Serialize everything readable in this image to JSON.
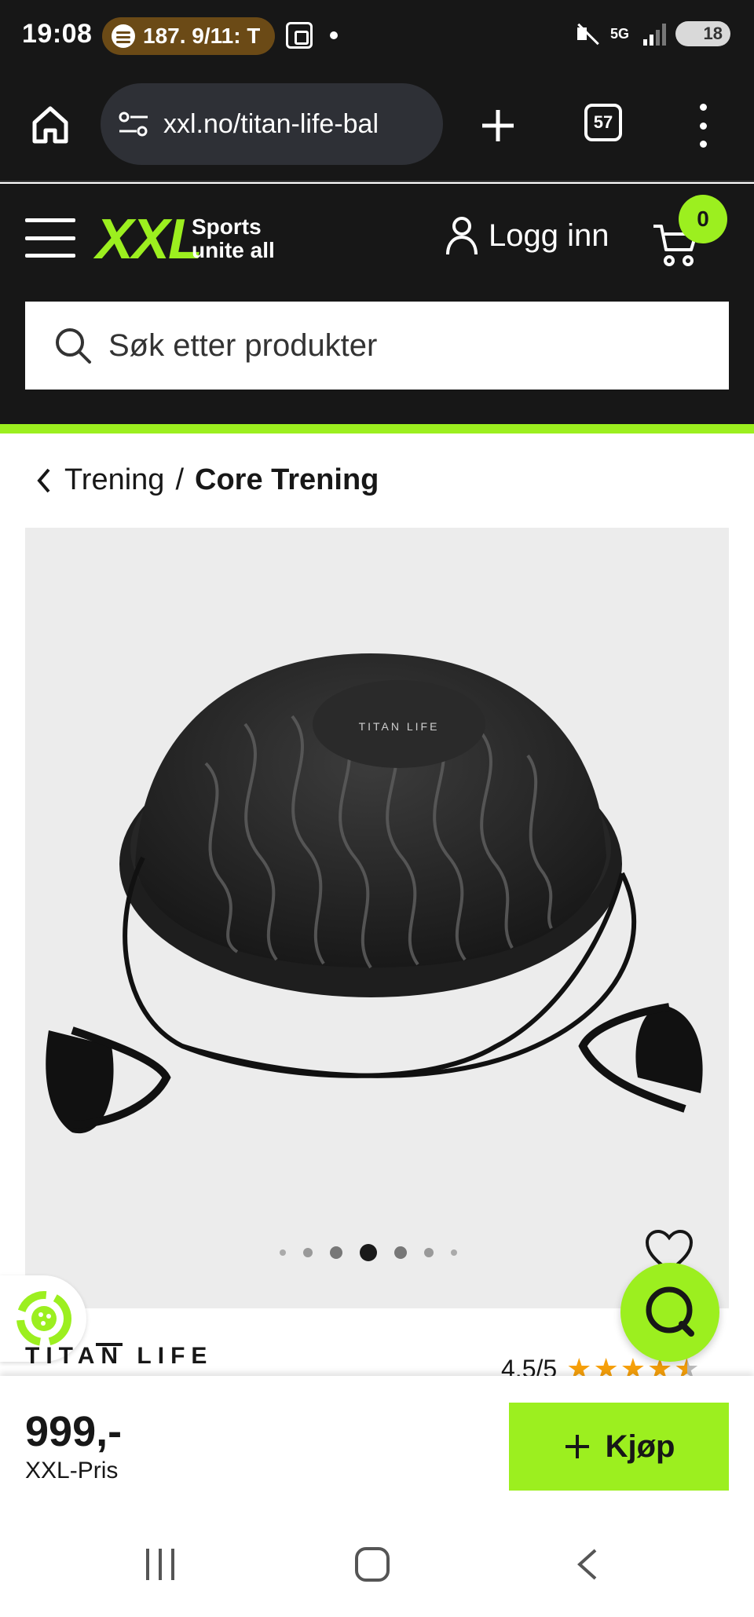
{
  "status_bar": {
    "time": "19:08",
    "media_text": "187. 9/11: T",
    "network": "5G",
    "battery": "18"
  },
  "browser": {
    "url": "xxl.no/titan-life-bal",
    "tab_count": "57"
  },
  "header": {
    "logo": "XXL",
    "tagline_line1": "Sports",
    "tagline_line2": "unite all",
    "login_label": "Logg inn",
    "cart_count": "0"
  },
  "search": {
    "placeholder": "Søk etter produkter"
  },
  "breadcrumb": {
    "parent": "Trening",
    "separator": "/",
    "current": "Core Trening"
  },
  "product": {
    "brand": "TITAN LIFE",
    "image_brand_text": "TITAN LIFE",
    "carousel": {
      "count": 7,
      "active_index": 3
    },
    "rating_text": "4.5/5",
    "rating_value": 4.5,
    "rating_max": 5,
    "price": "999,-",
    "price_label": "XXL-Pris",
    "buy_label": "Kjøp"
  },
  "colors": {
    "accent": "#9cef1f",
    "header_bg": "#171717",
    "star": "#f6a00b"
  }
}
